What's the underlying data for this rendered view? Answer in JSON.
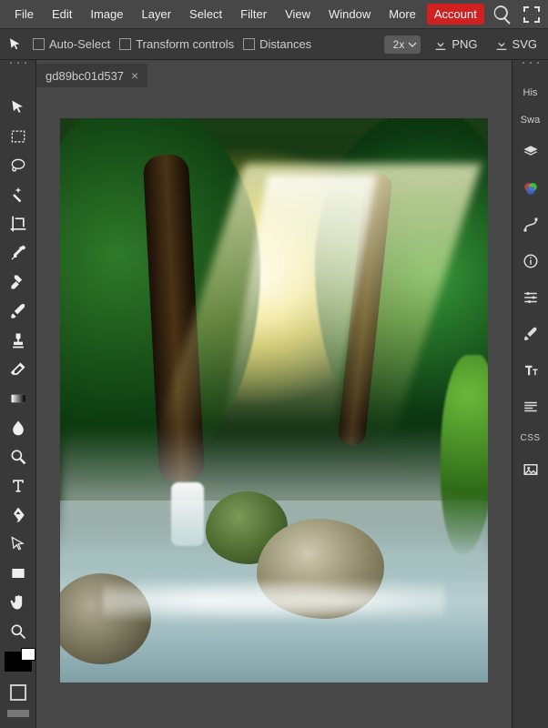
{
  "menu": {
    "items": [
      "File",
      "Edit",
      "Image",
      "Layer",
      "Select",
      "Filter",
      "View",
      "Window",
      "More"
    ],
    "account": "Account"
  },
  "options": {
    "auto_select": "Auto-Select",
    "transform_controls": "Transform controls",
    "distances": "Distances",
    "zoom": "2x",
    "export_png": "PNG",
    "export_svg": "SVG"
  },
  "tab": {
    "title": "gd89bc01d537"
  },
  "right_panel": {
    "history": "His",
    "swatches": "Swa",
    "css_label": "CSS"
  },
  "tools": [
    "move",
    "rect-select",
    "lasso",
    "magic-wand",
    "crop",
    "eyedropper",
    "heal",
    "brush",
    "stamp",
    "eraser",
    "gradient",
    "blur",
    "dodge",
    "pen",
    "text",
    "path-select",
    "hand",
    "rectangle",
    "shape",
    "zoom"
  ]
}
